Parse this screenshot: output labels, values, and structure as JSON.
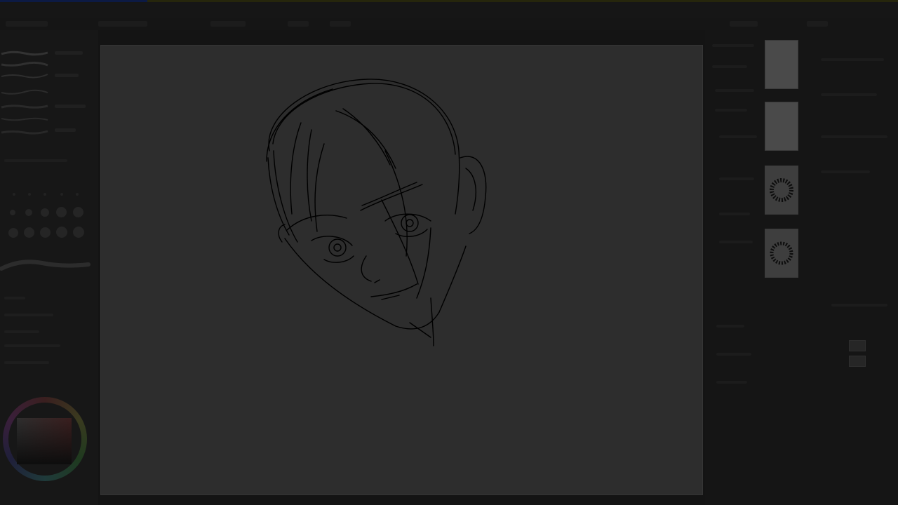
{
  "window": {
    "title": ""
  },
  "brush_panel": {
    "label": "brushes",
    "stroke_count": 7
  },
  "canvas": {
    "sketch": "head-sketch"
  },
  "texture_panel": {
    "items": [
      "paper-texture-1",
      "paper-texture-2",
      "spiky-brush-tip-1",
      "spiky-brush-tip-2"
    ]
  },
  "colors": {
    "background": "#141414",
    "canvas": "#2d2d2d",
    "ink": "#000000"
  }
}
